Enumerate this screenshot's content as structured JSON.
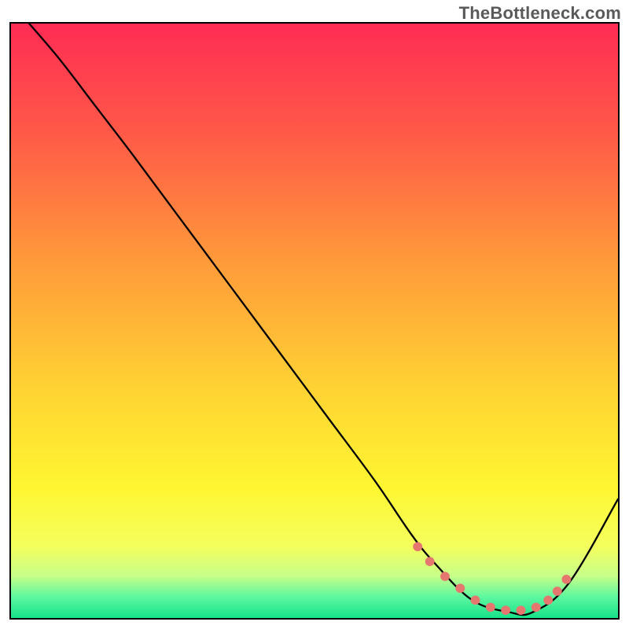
{
  "watermark": "TheBottleneck.com",
  "chart_data": {
    "type": "line",
    "title": "",
    "xlabel": "",
    "ylabel": "",
    "xlim": [
      0,
      100
    ],
    "ylim": [
      0,
      100
    ],
    "grid": false,
    "legend": false,
    "background": {
      "type": "vertical-gradient",
      "stops": [
        {
          "offset": 0.0,
          "color": "#ff2c54"
        },
        {
          "offset": 0.18,
          "color": "#ff5848"
        },
        {
          "offset": 0.4,
          "color": "#ff9a3a"
        },
        {
          "offset": 0.62,
          "color": "#ffd433"
        },
        {
          "offset": 0.78,
          "color": "#fff631"
        },
        {
          "offset": 0.88,
          "color": "#f4ff5e"
        },
        {
          "offset": 0.93,
          "color": "#c6ff8a"
        },
        {
          "offset": 0.965,
          "color": "#5cf7a0"
        },
        {
          "offset": 1.0,
          "color": "#17e28a"
        }
      ]
    },
    "series": [
      {
        "name": "bottleneck-curve",
        "color": "#000000",
        "x": [
          3,
          8,
          14,
          20,
          28,
          36,
          44,
          52,
          60,
          66,
          70,
          76,
          82,
          86,
          92,
          100
        ],
        "y": [
          100,
          94,
          86,
          78,
          67,
          56,
          45,
          34,
          23,
          14,
          9,
          3,
          1,
          1,
          6,
          20
        ]
      }
    ],
    "markers": {
      "name": "highlight-dots",
      "color": "#e6776f",
      "radius": 6,
      "x": [
        67.0,
        69.0,
        71.5,
        74.0,
        76.5,
        79.0,
        81.5,
        84.0,
        86.5,
        88.5,
        90.0,
        91.5
      ],
      "y": [
        12.0,
        9.5,
        7.0,
        5.0,
        3.0,
        1.8,
        1.3,
        1.3,
        1.8,
        3.0,
        4.5,
        6.5
      ]
    }
  }
}
